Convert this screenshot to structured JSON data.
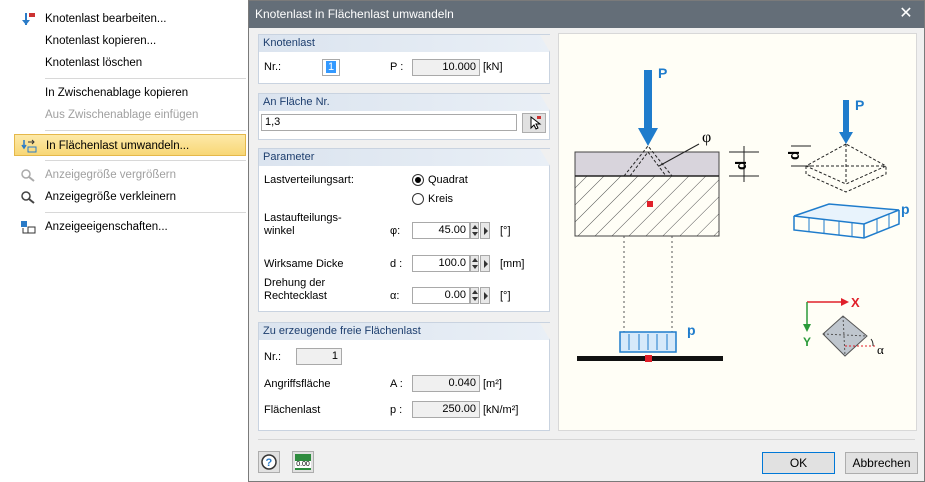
{
  "menu": {
    "items": [
      {
        "label": "Knotenlast bearbeiten...",
        "icon": "edit-load-icon",
        "disabled": false
      },
      {
        "label": "Knotenlast kopieren...",
        "icon": "",
        "disabled": false
      },
      {
        "label": "Knotenlast löschen",
        "icon": "",
        "disabled": false
      },
      {
        "label": "In Zwischenablage kopieren",
        "icon": "",
        "disabled": false
      },
      {
        "label": "Aus Zwischenablage einfügen",
        "icon": "",
        "disabled": true
      },
      {
        "label": "In Flächenlast umwandeln...",
        "icon": "convert-load-icon",
        "disabled": false,
        "selected": true
      },
      {
        "label": "Anzeigegröße vergrößern",
        "icon": "zoom-in-icon",
        "disabled": true
      },
      {
        "label": "Anzeigegröße verkleinern",
        "icon": "zoom-out-icon",
        "disabled": false
      },
      {
        "label": "Anzeigeeigenschaften...",
        "icon": "display-properties-icon",
        "disabled": false
      }
    ]
  },
  "dialog": {
    "title": "Knotenlast in Flächenlast umwandeln",
    "close_glyph": "✕",
    "knotenlast": {
      "header": "Knotenlast",
      "nr_label": "Nr.:",
      "nr_value": "1",
      "p_label": "P :",
      "p_value": "10.000",
      "p_unit": "[kN]"
    },
    "flaeche": {
      "header": "An Fläche Nr.",
      "value": "1,3"
    },
    "parameter": {
      "header": "Parameter",
      "lastverteilung_label": "Lastverteilungsart:",
      "radio_quadrat": "Quadrat",
      "radio_kreis": "Kreis",
      "quadrat_selected": true,
      "winkel_label_1": "Lastaufteilungs-",
      "winkel_label_2": "winkel",
      "winkel_sym": "φ:",
      "winkel_value": "45.00",
      "winkel_unit": "[°]",
      "dicke_label": "Wirksame Dicke",
      "dicke_sym": "d :",
      "dicke_value": "100.0",
      "dicke_unit": "[mm]",
      "drehung_label_1": "Drehung der",
      "drehung_label_2": "Rechtecklast",
      "drehung_sym": "α:",
      "drehung_value": "0.00",
      "drehung_unit": "[°]"
    },
    "erzeugt": {
      "header": "Zu erzeugende freie Flächenlast",
      "nr_label": "Nr.:",
      "nr_value": "1",
      "angriff_label": "Angriffsfläche",
      "angriff_sym": "A :",
      "angriff_value": "0.040",
      "angriff_unit": "[m²]",
      "flaeche_label": "Flächenlast",
      "flaeche_sym": "p :",
      "flaeche_value": "250.00",
      "flaeche_unit": "[kN/m²]"
    },
    "picture": {
      "P1": "P",
      "P2": "P",
      "phi": "φ",
      "d1": "d",
      "d2": "d",
      "p1": "p",
      "p2": "p",
      "X": "X",
      "Y": "Y",
      "alpha": "α"
    },
    "footer": {
      "ok": "OK",
      "cancel": "Abbrechen",
      "units_icon_text": "0.00"
    }
  },
  "colors": {
    "titlebar": "#646e78",
    "accent_blue": "#1f7ccc",
    "group_header": "#dbe4ef",
    "red": "#e0202a"
  }
}
